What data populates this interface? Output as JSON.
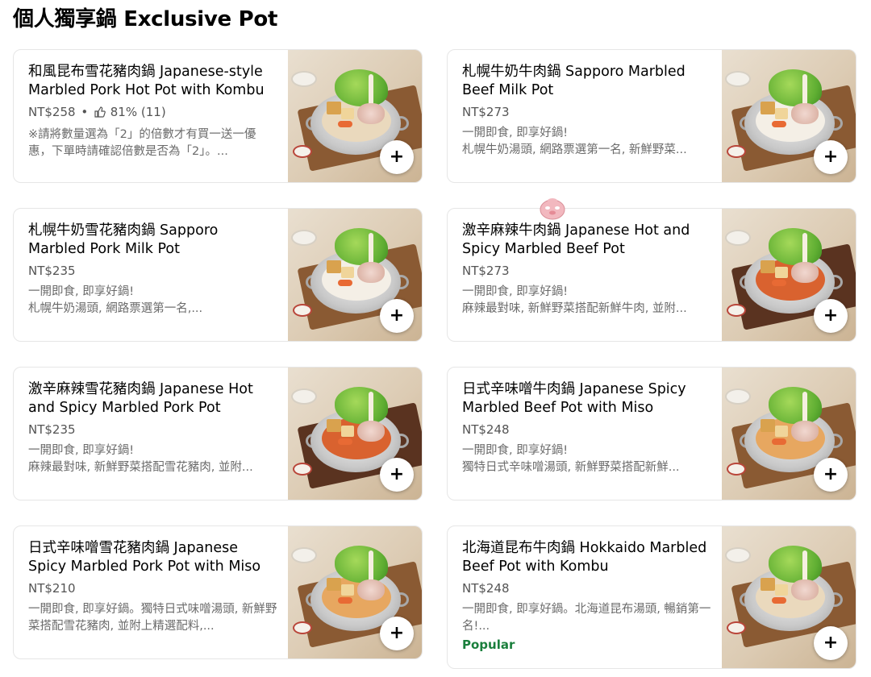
{
  "section": {
    "title": "個人獨享鍋 Exclusive Pot"
  },
  "icons": {
    "add": "plus-icon",
    "rating": "thumbs-up-icon"
  },
  "items": [
    {
      "name": "和風昆布雪花豬肉鍋 Japanese-style Marbled Pork Hot Pot with Kombu",
      "price": "NT$258",
      "separator": "•",
      "rating": "81% (11)",
      "description": "※請將數量選為「2」的倍數才有買一送一優惠，下單時請確認倍數是否為「2」。...",
      "add_label": "+"
    },
    {
      "name": "札幌牛奶牛肉鍋 Sapporo Marbled Beef Milk Pot",
      "price": "NT$273",
      "description": "一開即食, 即享好鍋!\n札幌牛奶湯頭, 網路票選第一名, 新鮮野菜...",
      "add_label": "+"
    },
    {
      "name": "札幌牛奶雪花豬肉鍋 Sapporo Marbled Pork Milk Pot",
      "price": "NT$235",
      "description": "一開即食, 即享好鍋!\n札幌牛奶湯頭, 網路票選第一名,...",
      "add_label": "+"
    },
    {
      "name": "激辛麻辣牛肉鍋 Japanese Hot and Spicy Marbled Beef Pot",
      "price": "NT$273",
      "description": "一開即食, 即享好鍋!\n麻辣最對味, 新鮮野菜搭配新鮮牛肉, 並附...",
      "add_label": "+"
    },
    {
      "name": "激辛麻辣雪花豬肉鍋 Japanese Hot and Spicy Marbled Pork Pot",
      "price": "NT$235",
      "description": "一開即食, 即享好鍋!\n麻辣最對味, 新鮮野菜搭配雪花豬肉, 並附...",
      "add_label": "+"
    },
    {
      "name": "日式辛味噌牛肉鍋 Japanese Spicy Marbled Beef Pot with Miso",
      "price": "NT$248",
      "description": "一開即食, 即享好鍋!\n獨特日式辛味噌湯頭, 新鮮野菜搭配新鮮...",
      "add_label": "+"
    },
    {
      "name": "日式辛味噌雪花豬肉鍋 Japanese Spicy Marbled Pork Pot with Miso",
      "price": "NT$210",
      "description": "一開即食, 即享好鍋。獨特日式味噌湯頭, 新鮮野菜搭配雪花豬肉, 並附上精選配料,...",
      "add_label": "+"
    },
    {
      "name": "北海道昆布牛肉鍋 Hokkaido Marbled Beef Pot with Kombu",
      "price": "NT$248",
      "description": "一開即食, 即享好鍋。北海道昆布湯頭, 暢銷第一名!...",
      "badge": "Popular",
      "add_label": "+"
    }
  ],
  "colors": {
    "badge": "#1a7f3c",
    "price": "#545454",
    "description": "#6b6b6b"
  }
}
